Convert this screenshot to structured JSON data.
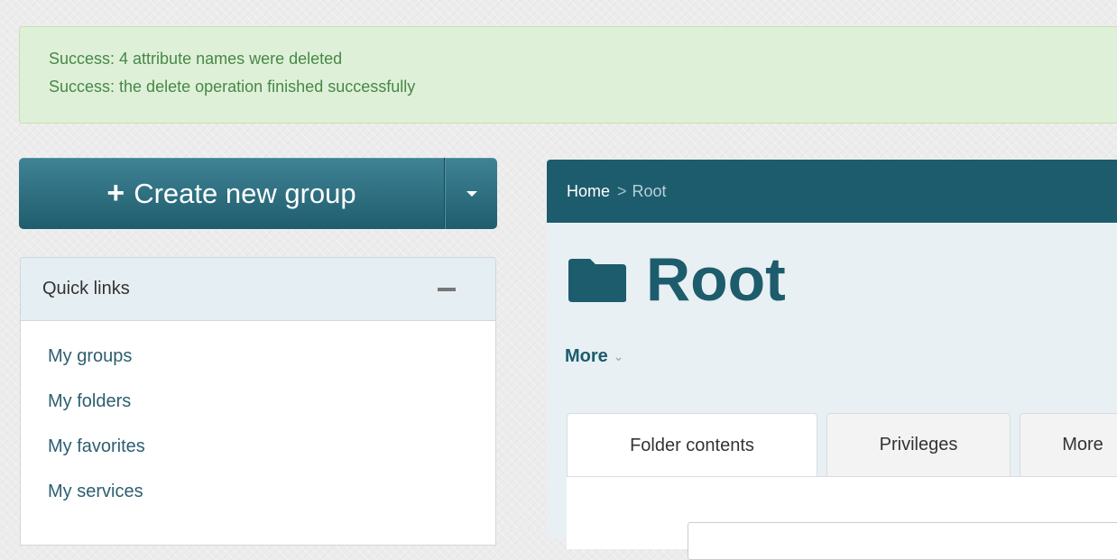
{
  "alerts": [
    "Success: 4 attribute names were deleted",
    "Success: the delete operation finished successfully"
  ],
  "create_button": {
    "icon": "plus-icon",
    "label": "Create new group"
  },
  "quick_links": {
    "title": "Quick links",
    "items": [
      "My groups",
      "My folders",
      "My favorites",
      "My services"
    ]
  },
  "breadcrumb": {
    "home": "Home",
    "separator": ">",
    "current": "Root"
  },
  "folder": {
    "icon": "folder-icon",
    "title": "Root"
  },
  "more_menu": {
    "label": "More",
    "chevron": "⌄"
  },
  "tabs": [
    {
      "label": "Folder contents",
      "active": true
    },
    {
      "label": "Privileges",
      "active": false
    },
    {
      "label": "More",
      "active": false
    }
  ],
  "colors": {
    "accent": "#1d5c6c",
    "success_bg": "#dff0d8",
    "success_text": "#468847",
    "panel_header": "#e5eef2"
  }
}
